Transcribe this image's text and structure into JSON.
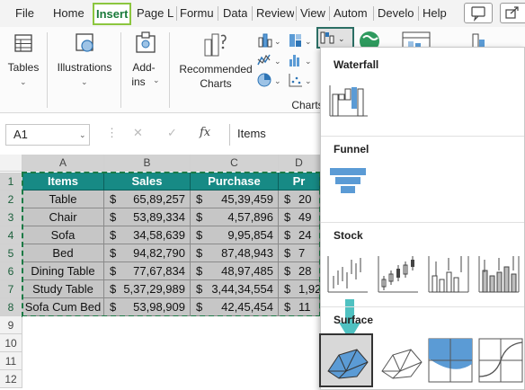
{
  "tabs": [
    {
      "label": "File",
      "active": false
    },
    {
      "label": "Home",
      "active": false
    },
    {
      "label": "Insert",
      "active": true
    },
    {
      "label": "Page L",
      "active": false
    },
    {
      "label": "Formu",
      "active": false
    },
    {
      "label": "Data",
      "active": false
    },
    {
      "label": "Review",
      "active": false
    },
    {
      "label": "View",
      "active": false
    },
    {
      "label": "Autom",
      "active": false
    },
    {
      "label": "Develo",
      "active": false
    },
    {
      "label": "Help",
      "active": false
    }
  ],
  "ribbon": {
    "tables_label": "Tables",
    "illustrations_label": "Illustrations",
    "addins_label_1": "Add-",
    "addins_label_2": "ins",
    "recommended_1": "Recommended",
    "recommended_2": "Charts",
    "group_charts": "Charts"
  },
  "formula_bar": {
    "name_box": "A1",
    "cancel_glyph": "✕",
    "enter_glyph": "✓",
    "fx_label": "fx",
    "value": "Items"
  },
  "sheet": {
    "columns": [
      "A",
      "B",
      "C",
      "D"
    ],
    "rows": [
      "1",
      "2",
      "3",
      "4",
      "5",
      "6",
      "7",
      "8",
      "9",
      "10",
      "11",
      "12"
    ],
    "headers": [
      "Items",
      "Sales",
      "Purchase",
      "Pr"
    ],
    "data": [
      {
        "item": "Table",
        "sales": "65,89,257",
        "purchase": "45,39,459",
        "pr": "20"
      },
      {
        "item": "Chair",
        "sales": "53,89,334",
        "purchase": "4,57,896",
        "pr": "49"
      },
      {
        "item": "Sofa",
        "sales": "34,58,639",
        "purchase": "9,95,854",
        "pr": "24"
      },
      {
        "item": "Bed",
        "sales": "94,82,790",
        "purchase": "87,48,943",
        "pr": "7"
      },
      {
        "item": "Dining Table",
        "sales": "77,67,834",
        "purchase": "48,97,485",
        "pr": "28"
      },
      {
        "item": "Study Table",
        "sales": "5,37,29,989",
        "purchase": "3,44,34,554",
        "pr": "1,92"
      },
      {
        "item": "Sofa Cum Bed",
        "sales": "53,98,909",
        "purchase": "42,45,454",
        "pr": "11"
      }
    ],
    "currency": "$"
  },
  "dropdown": {
    "waterfall": "Waterfall",
    "funnel": "Funnel",
    "stock": "Stock",
    "surface": "Surface"
  },
  "colors": {
    "accent_green": "#1a7a3a",
    "tab_border": "#8cc63f",
    "header_teal": "#178a85",
    "cell_gray": "#c6c6c6",
    "chart_blue": "#5b9bd5",
    "arrow_teal": "#4fc1c1"
  }
}
